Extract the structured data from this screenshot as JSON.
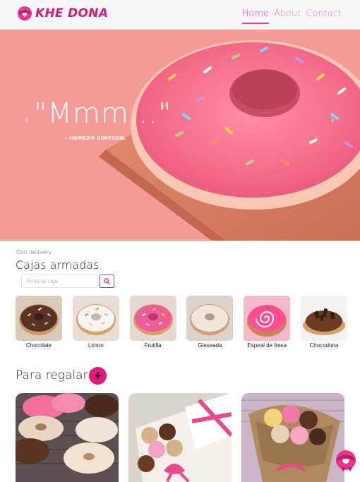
{
  "brand": {
    "name": "KHE DONA",
    "logo_icon": "donut-logo-icon"
  },
  "nav": {
    "items": [
      {
        "label": "Home",
        "active": true
      },
      {
        "label": "About",
        "active": false
      },
      {
        "label": "Contact",
        "active": false
      }
    ]
  },
  "hero": {
    "quote": "\"Mmm...\"",
    "author": "- HOMERO SIMPSON.",
    "prev_icon": "chevron-left-icon",
    "next_icon": "chevron-right-icon"
  },
  "cajas": {
    "kicker": "Con delivery",
    "title": "Cajas armadas",
    "search": {
      "placeholder": "Arma tu caja",
      "value": ""
    },
    "items": [
      {
        "label": "Chocolate"
      },
      {
        "label": "Limon"
      },
      {
        "label": "Frutilla"
      },
      {
        "label": "Glaseada"
      },
      {
        "label": "Espiral de fresa"
      },
      {
        "label": "Chocodona"
      }
    ]
  },
  "regalar": {
    "title": "Para regalar!",
    "add_label": "+"
  },
  "colors": {
    "accent": "#ea167f",
    "nav_link": "#ef7cb3",
    "hero_bg": "#f39b97"
  }
}
